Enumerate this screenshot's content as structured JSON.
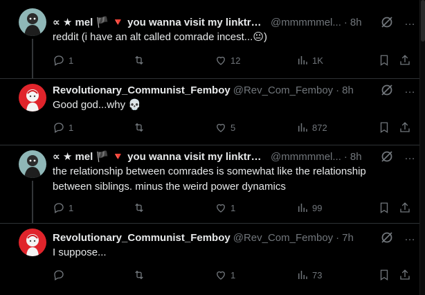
{
  "tweets": [
    {
      "name": "∝ ★ mel 🏴 🔻 you wanna visit my linktre...",
      "handle": "@mmmmmel...",
      "time": "8h",
      "text": "reddit (i have an alt called comrade incest...😐)",
      "replies": "1",
      "retweets": "",
      "likes": "12",
      "views": "1K"
    },
    {
      "name": "Revolutionary_Communist_Femboy",
      "handle": "@Rev_Com_Femboy",
      "time": "8h",
      "text": "Good god...why 💀",
      "replies": "1",
      "retweets": "",
      "likes": "5",
      "views": "872"
    },
    {
      "name": "∝ ★ mel 🏴 🔻 you wanna visit my linktre...",
      "handle": "@mmmmmel...",
      "time": "8h",
      "text": "the relationship between comrades is somewhat like the relationship between siblings. minus the weird power dynamics",
      "replies": "1",
      "retweets": "",
      "likes": "1",
      "views": "99"
    },
    {
      "name": "Revolutionary_Communist_Femboy",
      "handle": "@Rev_Com_Femboy",
      "time": "7h",
      "text": "I suppose...",
      "replies": "",
      "retweets": "",
      "likes": "1",
      "views": "73"
    }
  ],
  "separator": "·",
  "more_glyph": "…",
  "icons": [
    "reply-icon",
    "retweet-icon",
    "like-icon",
    "views-icon",
    "bookmark-icon",
    "share-icon",
    "grok-icon",
    "more-icon"
  ],
  "colors": {
    "background": "#000000",
    "text": "#e7e9ea",
    "muted": "#71767b",
    "divider": "#2f3336"
  }
}
